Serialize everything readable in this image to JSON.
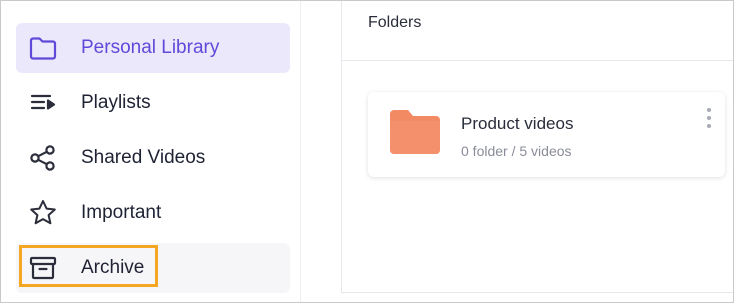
{
  "sidebar": {
    "items": [
      {
        "label": "Personal Library",
        "icon": "folder-icon",
        "state": "active"
      },
      {
        "label": "Playlists",
        "icon": "playlist-icon",
        "state": "default"
      },
      {
        "label": "Shared Videos",
        "icon": "share-icon",
        "state": "default"
      },
      {
        "label": "Important",
        "icon": "star-icon",
        "state": "default"
      },
      {
        "label": "Archive",
        "icon": "archive-icon",
        "state": "highlighted"
      }
    ]
  },
  "main": {
    "section_title": "Folders",
    "folders": [
      {
        "name": "Product videos",
        "meta": "0 folder / 5 videos",
        "icon": "folder-icon"
      }
    ]
  },
  "colors": {
    "accent": "#6049d9",
    "active_bg": "#ebe8fb",
    "folder": "#f28a64",
    "highlight": "#f5a623"
  }
}
